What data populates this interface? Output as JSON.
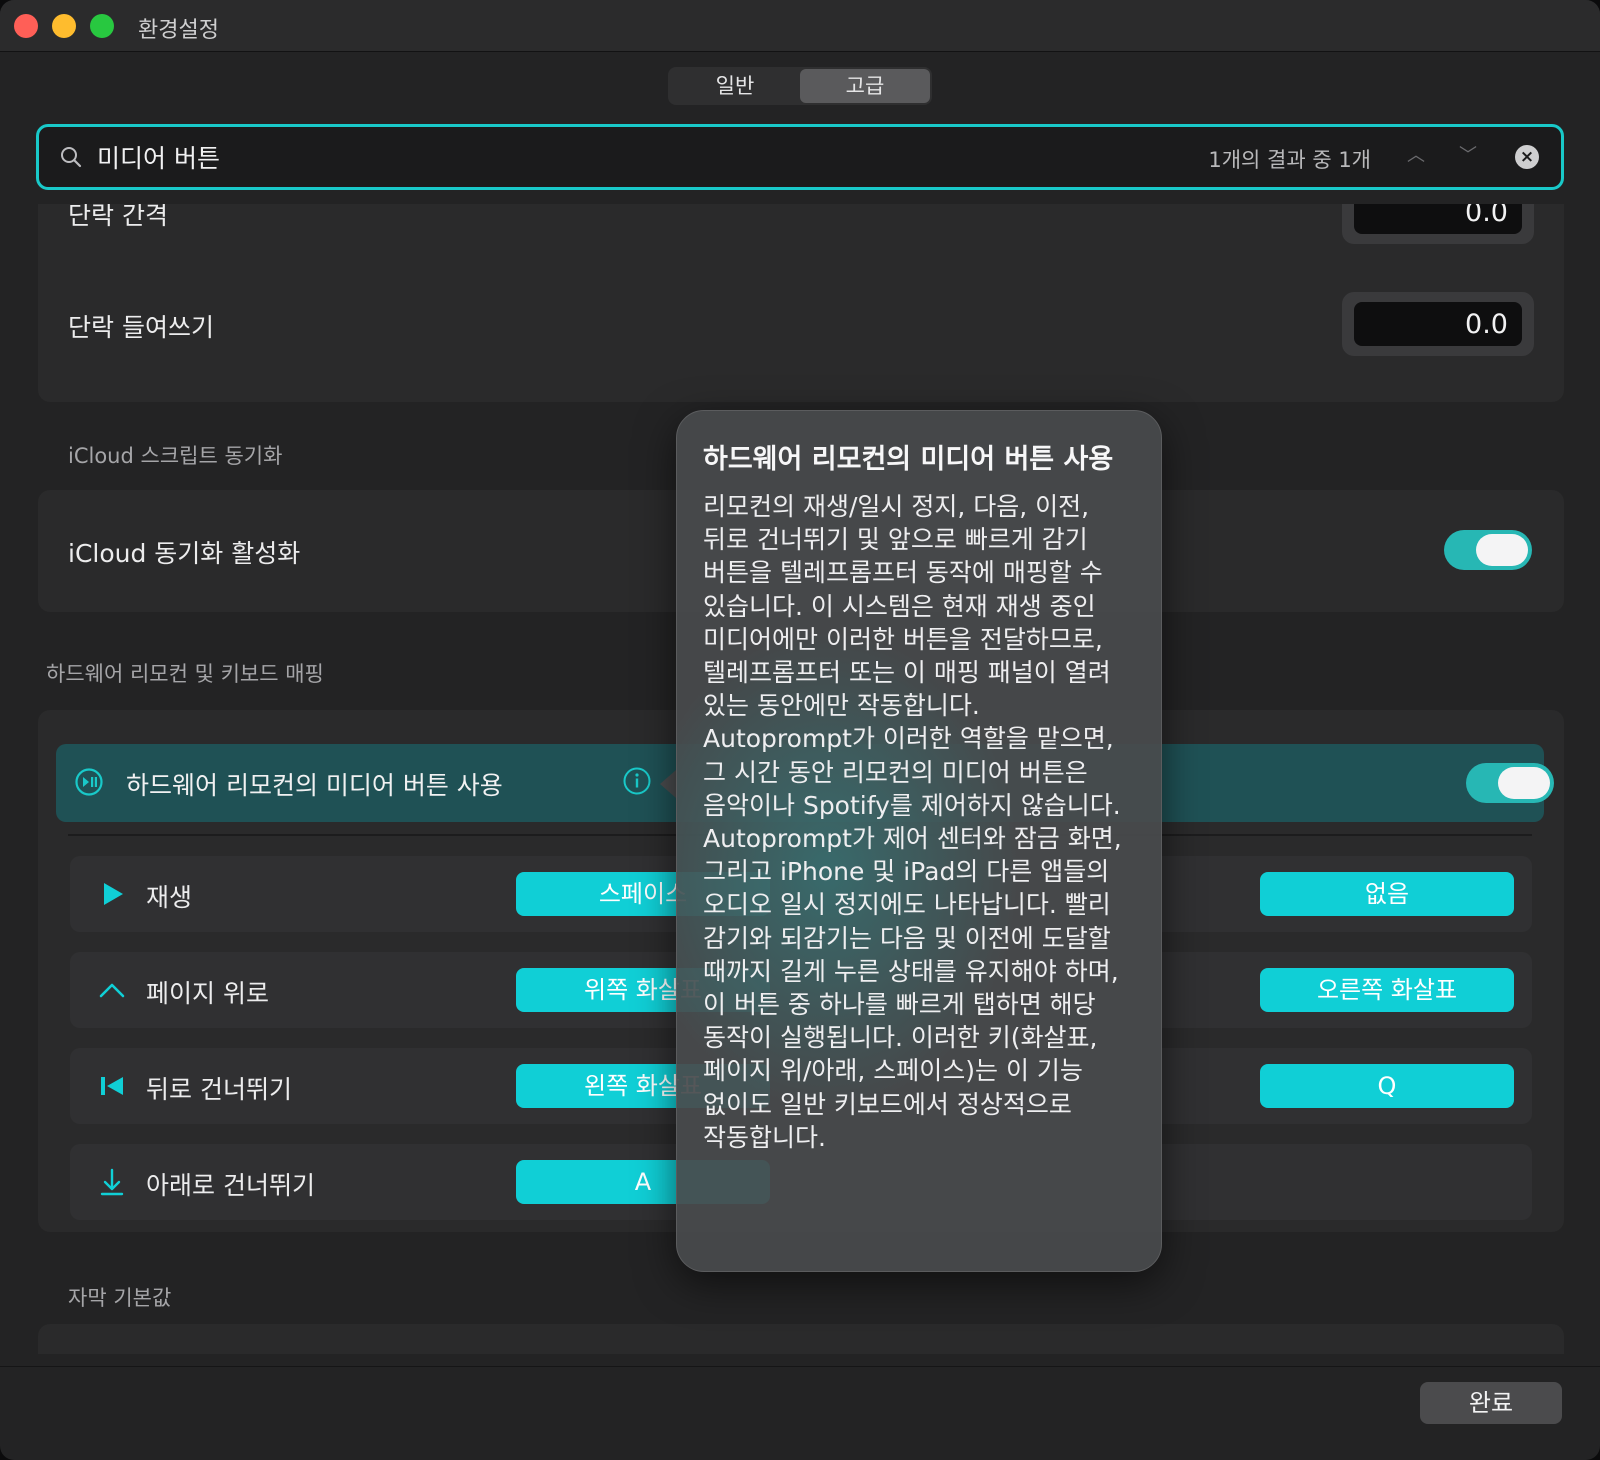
{
  "window": {
    "title": "환경설정"
  },
  "tabs": [
    {
      "label": "일반"
    },
    {
      "label": "고급"
    }
  ],
  "search": {
    "value": "미디어 버튼",
    "result_count": "1개의 결과 중 1개"
  },
  "paragraph": {
    "spacing_label": "단락 간격",
    "spacing_value": "0.0",
    "indent_label": "단락 들여쓰기",
    "indent_value": "0.0"
  },
  "icloud": {
    "section_title": "iCloud 스크립트 동기화",
    "toggle_label": "iCloud 동기화 활성화",
    "enabled": true
  },
  "hardware": {
    "section_title": "하드웨어 리모컨 및 키보드 매핑",
    "media_row_label": "하드웨어 리모컨의 미디어 버튼 사용",
    "enabled": true,
    "mappings": [
      {
        "label": "재생",
        "icon": "play-icon",
        "key1": "스페이스",
        "key2": "없음"
      },
      {
        "label": "페이지 위로",
        "icon": "chevron-up-icon",
        "key1": "위쪽 화살표",
        "key2": "오른쪽 화살표"
      },
      {
        "label": "뒤로 건너뛰기",
        "icon": "skip-back-icon",
        "key1": "왼쪽 화살표",
        "key2": "Q"
      },
      {
        "label": "아래로 건너뛰기",
        "icon": "arrow-down-icon",
        "key1": "A"
      }
    ]
  },
  "popover": {
    "title": "하드웨어 리모컨의 미디어 버튼 사용",
    "body": "리모컨의 재생/일시 정지, 다음, 이전, 뒤로 건너뛰기 및 앞으로 빠르게 감기 버튼을 텔레프롬프터 동작에 매핑할 수 있습니다. 이 시스템은 현재 재생 중인 미디어에만 이러한 버튼을 전달하므로, 텔레프롬프터 또는 이 매핑 패널이 열려 있는 동안에만 작동합니다. Autoprompt가 이러한 역할을 맡으면, 그 시간 동안 리모컨의 미디어 버튼은 음악이나 Spotify를 제어하지 않습니다. Autoprompt가 제어 센터와 잠금 화면, 그리고 iPhone 및 iPad의 다른 앱들의 오디오 일시 정지에도 나타납니다. 빨리 감기와 되감기는 다음 및 이전에 도달할 때까지 길게 누른 상태를 유지해야 하며, 이 버튼 중 하나를 빠르게 탭하면 해당 동작이 실행됩니다. 이러한 키(화살표, 페이지 위/아래, 스페이스)는 이 기능 없이도 일반 키보드에서 정상적으로 작동합니다."
  },
  "subtitle_defaults": {
    "section_title": "자막 기본값"
  },
  "footer": {
    "done_label": "완료"
  },
  "colors": {
    "accent": "#19c9c9",
    "key_button": "#10cfd6",
    "highlight_row": "#1f5155"
  }
}
